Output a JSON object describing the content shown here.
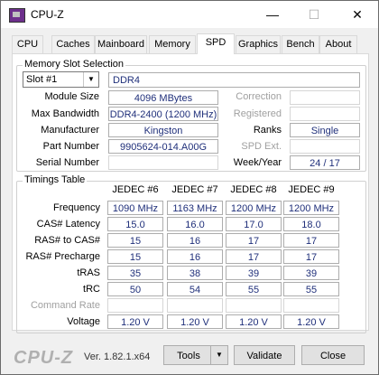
{
  "window": {
    "title": "CPU-Z",
    "minimize": "—",
    "maximize": "☐",
    "close": "✕"
  },
  "tabs": [
    "CPU",
    "Caches",
    "Mainboard",
    "Memory",
    "SPD",
    "Graphics",
    "Bench",
    "About"
  ],
  "active_tab": "SPD",
  "memory_slot": {
    "group_title": "Memory Slot Selection",
    "slot": "Slot #1",
    "type": "DDR4",
    "module_size_label": "Module Size",
    "module_size": "4096 MBytes",
    "max_bandwidth_label": "Max Bandwidth",
    "max_bandwidth": "DDR4-2400 (1200 MHz)",
    "manufacturer_label": "Manufacturer",
    "manufacturer": "Kingston",
    "part_number_label": "Part Number",
    "part_number": "9905624-014.A00G",
    "serial_number_label": "Serial Number",
    "serial_number": "",
    "correction_label": "Correction",
    "correction": "",
    "registered_label": "Registered",
    "registered": "",
    "ranks_label": "Ranks",
    "ranks": "Single",
    "spd_ext_label": "SPD Ext.",
    "spd_ext": "",
    "week_year_label": "Week/Year",
    "week_year": "24 / 17"
  },
  "timings": {
    "group_title": "Timings Table",
    "columns": [
      "JEDEC #6",
      "JEDEC #7",
      "JEDEC #8",
      "JEDEC #9"
    ],
    "rows": [
      {
        "label": "Frequency",
        "values": [
          "1090 MHz",
          "1163 MHz",
          "1200 MHz",
          "1200 MHz"
        ]
      },
      {
        "label": "CAS# Latency",
        "values": [
          "15.0",
          "16.0",
          "17.0",
          "18.0"
        ]
      },
      {
        "label": "RAS# to CAS#",
        "values": [
          "15",
          "16",
          "17",
          "17"
        ]
      },
      {
        "label": "RAS# Precharge",
        "values": [
          "15",
          "16",
          "17",
          "17"
        ]
      },
      {
        "label": "tRAS",
        "values": [
          "35",
          "38",
          "39",
          "39"
        ]
      },
      {
        "label": "tRC",
        "values": [
          "50",
          "54",
          "55",
          "55"
        ]
      },
      {
        "label": "Command Rate",
        "values": [
          "",
          "",
          "",
          ""
        ]
      },
      {
        "label": "Voltage",
        "values": [
          "1.20 V",
          "1.20 V",
          "1.20 V",
          "1.20 V"
        ]
      }
    ]
  },
  "footer": {
    "logo": "CPU-Z",
    "version": "Ver. 1.82.1.x64",
    "tools": "Tools",
    "validate": "Validate",
    "close": "Close"
  }
}
